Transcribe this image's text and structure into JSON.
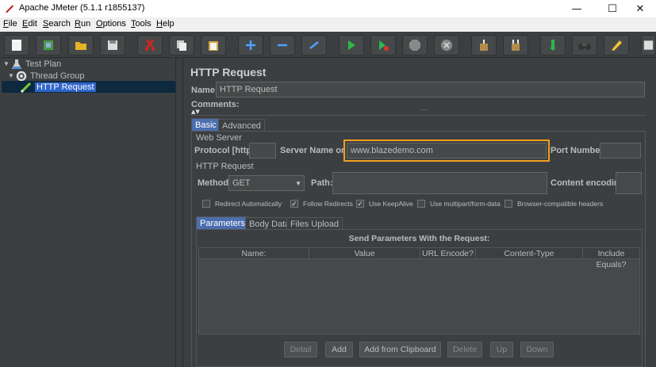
{
  "window": {
    "title": "Apache JMeter (5.1.1 r1855137)",
    "minimize_glyph": "—",
    "maximize_glyph": "☐",
    "close_glyph": "✕"
  },
  "menu": [
    "File",
    "Edit",
    "Search",
    "Run",
    "Options",
    "Tools",
    "Help"
  ],
  "toolbar": {
    "icons": [
      "new-icon",
      "templates-icon",
      "open-icon",
      "save-icon",
      "cut-icon",
      "copy-icon",
      "paste-icon",
      "expand-icon",
      "collapse-icon",
      "toggle-icon",
      "start-icon",
      "start-no-pause-icon",
      "stop-icon",
      "shutdown-icon",
      "clear-icon",
      "clear-all-icon",
      "search-icon",
      "reset-search-icon",
      "function-helper-icon",
      "help-icon"
    ]
  },
  "tree": {
    "nodes": [
      {
        "label": "Test Plan",
        "icon": "test-plan-icon"
      },
      {
        "label": "Thread Group",
        "icon": "thread-group-icon"
      },
      {
        "label": "HTTP Request",
        "icon": "http-request-icon",
        "selected": true
      }
    ]
  },
  "panel": {
    "heading": "HTTP Request",
    "name_label": "Name:",
    "name_value": "HTTP Request",
    "comments_label": "Comments:",
    "tabs": [
      "Basic",
      "Advanced"
    ],
    "active_tab": "Basic",
    "web_server": {
      "heading": "Web Server",
      "protocol_label": "Protocol [http]:",
      "protocol_value": "",
      "server_label": "Server Name or IP:",
      "server_value": "www.blazedemo.com",
      "port_label": "Port Number:",
      "port_value": ""
    },
    "http_request": {
      "heading": "HTTP Request",
      "method_label": "Method:",
      "method_value": "GET",
      "path_label": "Path:",
      "path_value": "",
      "encoding_label": "Content encoding:",
      "encoding_value": ""
    },
    "checkboxes": [
      {
        "label": "Redirect Automatically",
        "checked": false
      },
      {
        "label": "Follow Redirects",
        "checked": true
      },
      {
        "label": "Use KeepAlive",
        "checked": true
      },
      {
        "label": "Use multipart/form-data",
        "checked": false
      },
      {
        "label": "Browser-compatible headers",
        "checked": false
      }
    ],
    "sub_tabs": [
      "Parameters",
      "Body Data",
      "Files Upload"
    ],
    "active_sub_tab": "Parameters",
    "params_title": "Send Parameters With the Request:",
    "columns": [
      "Name:",
      "Value",
      "URL Encode?",
      "Content-Type",
      "Include Equals?"
    ],
    "buttons": [
      "Detail",
      "Add",
      "Add from Clipboard",
      "Delete",
      "Up",
      "Down"
    ]
  }
}
